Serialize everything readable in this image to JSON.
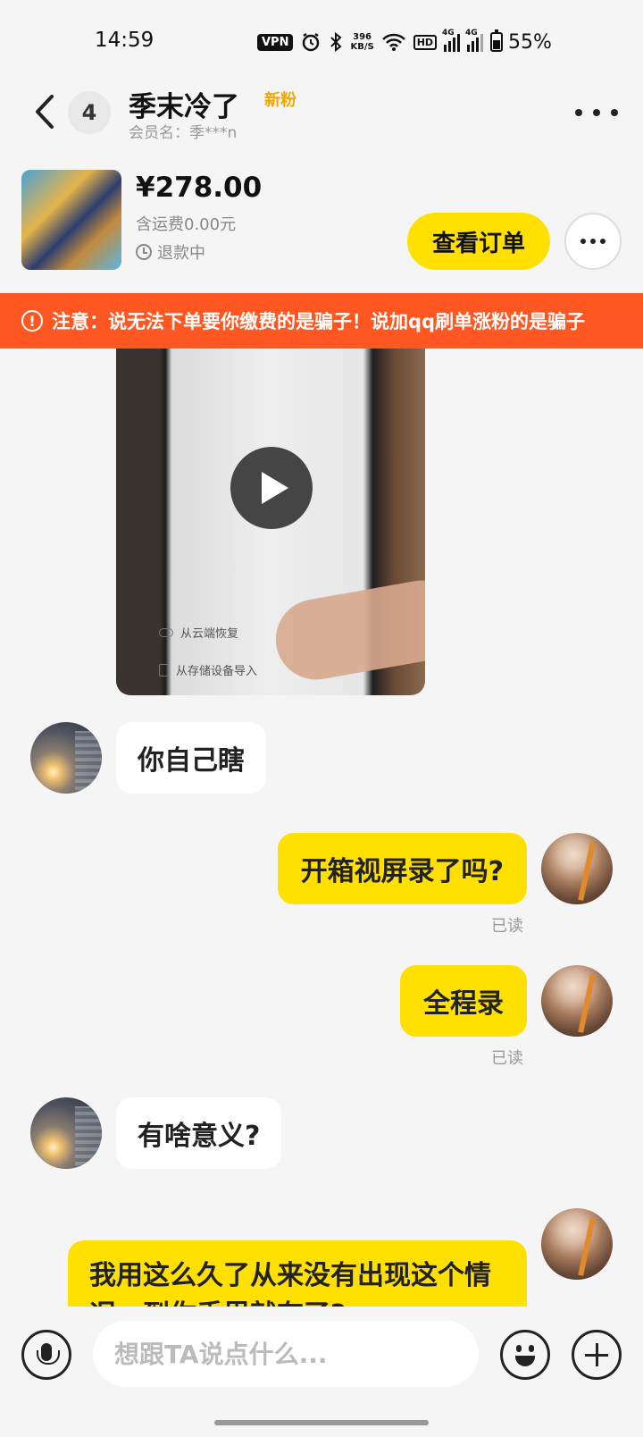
{
  "status_bar": {
    "time": "14:59",
    "vpn": "VPN",
    "net_speed_value": "396",
    "net_speed_unit": "KB/S",
    "hd": "HD",
    "signal_label": "4G",
    "battery": "55%",
    "battery_level": 0.55
  },
  "header": {
    "back_icon": "chevron-left-icon",
    "unread_count": "4",
    "name": "季末冷了",
    "badge": "新粉",
    "member_label": "会员名：季***n",
    "more_icon": "more-horizontal-icon"
  },
  "order": {
    "price": "¥278.00",
    "shipping": "含运费0.00元",
    "status": "退款中",
    "view_order_label": "查看订单"
  },
  "warning": {
    "icon": "alert-circle-icon",
    "text": "注意：说无法下单要你缴费的是骗子！说加qq刷单涨粉的是骗子"
  },
  "video": {
    "caption_1": "从云端恢复",
    "caption_2": "从存储设备导入",
    "play_icon": "play-icon"
  },
  "messages": [
    {
      "from": "other",
      "text": "你自己瞎"
    },
    {
      "from": "self",
      "text": "开箱视屏录了吗?",
      "read": "已读"
    },
    {
      "from": "self",
      "text": "全程录",
      "read": "已读"
    },
    {
      "from": "other",
      "text": "有啥意义?"
    },
    {
      "from": "self",
      "text": "我用这么久了从来没有出现这个情况，到你手里就有了?"
    }
  ],
  "input_bar": {
    "placeholder": "想跟TA说点什么...",
    "voice_icon": "microphone-icon",
    "emoji_icon": "emoji-icon",
    "plus_icon": "plus-icon"
  },
  "colors": {
    "accent_yellow": "#ffe000",
    "warning_orange": "#ff5722",
    "badge_yellow": "#f0a800",
    "background": "#f5f5f5"
  }
}
